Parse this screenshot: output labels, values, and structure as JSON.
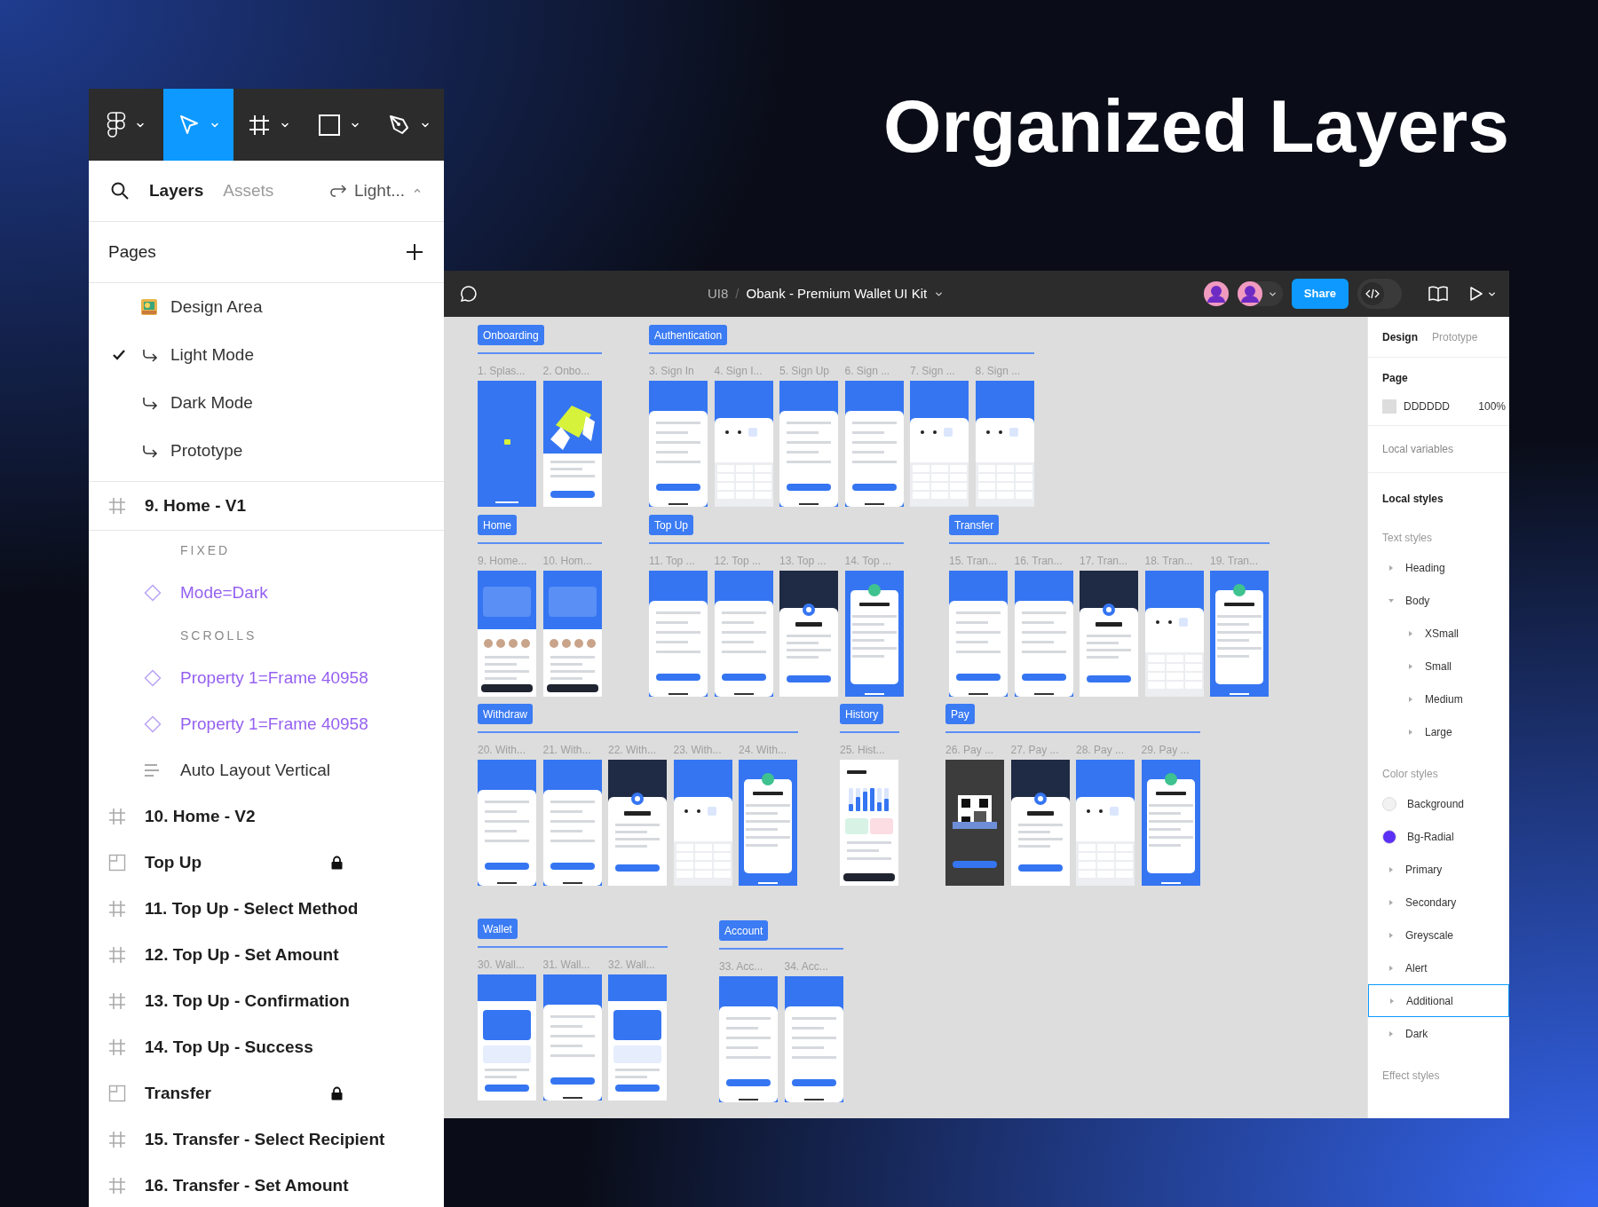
{
  "headline": "Organized Layers",
  "toolbar": {
    "tools": [
      {
        "kind": "logo",
        "selected": false
      },
      {
        "kind": "move",
        "selected": true
      },
      {
        "kind": "frame",
        "selected": false
      },
      {
        "kind": "rectangle",
        "selected": false
      },
      {
        "kind": "pen",
        "selected": false
      }
    ]
  },
  "layers_panel": {
    "tabs": [
      {
        "label": "Layers",
        "selected": true
      },
      {
        "label": "Assets",
        "selected": false
      }
    ],
    "page_switcher": "Light...",
    "pages_title": "Pages",
    "pages": [
      {
        "label": "Design Area",
        "kind": "emoji",
        "selected": false
      },
      {
        "label": "Light Mode",
        "kind": "link",
        "selected": true
      },
      {
        "label": "Dark Mode",
        "kind": "link",
        "selected": false
      },
      {
        "label": "Prototype",
        "kind": "link",
        "selected": false
      }
    ],
    "layers": [
      {
        "label": "9. Home - V1",
        "kind": "frame",
        "expanded": true,
        "children": [
          {
            "label": "FIXED",
            "kind": "group_label"
          },
          {
            "label": "Mode=Dark",
            "kind": "component"
          },
          {
            "label": "SCROLLS",
            "kind": "group_label"
          },
          {
            "label": "Property 1=Frame 40958",
            "kind": "component"
          },
          {
            "label": "Property 1=Frame 40958",
            "kind": "component"
          },
          {
            "label": "Auto Layout Vertical",
            "kind": "auto_layout"
          }
        ]
      },
      {
        "label": "10. Home - V2",
        "kind": "frame"
      },
      {
        "label": "Top Up",
        "kind": "section",
        "locked": true
      },
      {
        "label": "11. Top Up - Select Method",
        "kind": "frame"
      },
      {
        "label": "12. Top Up - Set Amount",
        "kind": "frame"
      },
      {
        "label": "13. Top Up - Confirmation",
        "kind": "frame"
      },
      {
        "label": "14. Top Up - Success",
        "kind": "frame"
      },
      {
        "label": "Transfer",
        "kind": "section",
        "locked": true
      },
      {
        "label": "15. Transfer - Select Recipient",
        "kind": "frame"
      },
      {
        "label": "16. Transfer - Set Amount",
        "kind": "frame"
      }
    ]
  },
  "editor": {
    "breadcrumb": {
      "team": "UI8",
      "separator": "/",
      "file": "Obank - Premium Wallet UI Kit"
    },
    "share_button": "Share",
    "dev_mode_on": false,
    "canvas": {
      "sections": [
        {
          "label": "Onboarding",
          "frames": [
            {
              "title": "1. Splas...",
              "kind": "splash"
            },
            {
              "title": "2. Onbo...",
              "kind": "illustration"
            }
          ]
        },
        {
          "label": "Authentication",
          "frames": [
            {
              "title": "3. Sign In",
              "kind": "form"
            },
            {
              "title": "4. Sign I...",
              "kind": "keypad"
            },
            {
              "title": "5. Sign Up",
              "kind": "form"
            },
            {
              "title": "6. Sign ...",
              "kind": "form"
            },
            {
              "title": "7. Sign ...",
              "kind": "keypad"
            },
            {
              "title": "8. Sign ...",
              "kind": "keypad"
            }
          ]
        },
        {
          "label": "Home",
          "frames": [
            {
              "title": "9. Home...",
              "kind": "home"
            },
            {
              "title": "10. Hom...",
              "kind": "home"
            }
          ]
        },
        {
          "label": "Top Up",
          "frames": [
            {
              "title": "11. Top ...",
              "kind": "form"
            },
            {
              "title": "12. Top ...",
              "kind": "form"
            },
            {
              "title": "13. Top ...",
              "kind": "dark"
            },
            {
              "title": "14. Top ...",
              "kind": "success"
            }
          ]
        },
        {
          "label": "Transfer",
          "frames": [
            {
              "title": "15. Tran...",
              "kind": "form"
            },
            {
              "title": "16. Tran...",
              "kind": "form"
            },
            {
              "title": "17. Tran...",
              "kind": "dark"
            },
            {
              "title": "18. Tran...",
              "kind": "keypad"
            },
            {
              "title": "19. Tran...",
              "kind": "success"
            }
          ]
        },
        {
          "label": "Withdraw",
          "frames": [
            {
              "title": "20. With...",
              "kind": "form"
            },
            {
              "title": "21. With...",
              "kind": "form"
            },
            {
              "title": "22. With...",
              "kind": "dark"
            },
            {
              "title": "23. With...",
              "kind": "keypad"
            },
            {
              "title": "24. With...",
              "kind": "success"
            }
          ]
        },
        {
          "label": "History",
          "frames": [
            {
              "title": "25. Hist...",
              "kind": "chart"
            }
          ]
        },
        {
          "label": "Pay",
          "frames": [
            {
              "title": "26. Pay ...",
              "kind": "qr"
            },
            {
              "title": "27. Pay ...",
              "kind": "dark"
            },
            {
              "title": "28. Pay ...",
              "kind": "keypad"
            },
            {
              "title": "29. Pay ...",
              "kind": "success"
            }
          ]
        },
        {
          "label": "Wallet",
          "frames": [
            {
              "title": "30. Wall...",
              "kind": "wallet"
            },
            {
              "title": "31. Wall...",
              "kind": "form"
            },
            {
              "title": "32. Wall...",
              "kind": "wallet"
            }
          ]
        },
        {
          "label": "Account",
          "frames": [
            {
              "title": "33. Acc...",
              "kind": "form"
            },
            {
              "title": "34. Acc...",
              "kind": "form"
            }
          ]
        }
      ]
    },
    "properties": {
      "tabs": [
        {
          "label": "Design",
          "selected": true
        },
        {
          "label": "Prototype",
          "selected": false
        }
      ],
      "page_title": "Page",
      "page_fill": {
        "hex": "DDDDDD",
        "opacity": "100%"
      },
      "local_variables": "Local variables",
      "local_styles": "Local styles",
      "text_styles_title": "Text styles",
      "text_styles": [
        {
          "label": "Heading",
          "expanded": false
        },
        {
          "label": "Body",
          "expanded": true,
          "children": [
            {
              "label": "XSmall",
              "expanded": false
            },
            {
              "label": "Small",
              "expanded": false
            },
            {
              "label": "Medium",
              "expanded": false
            },
            {
              "label": "Large",
              "expanded": false
            }
          ]
        }
      ],
      "color_styles_title": "Color styles",
      "color_styles": [
        {
          "label": "Background",
          "kind": "swatch",
          "color": "#f2f2f2",
          "selected": false
        },
        {
          "label": "Bg-Radial",
          "kind": "swatch",
          "color": "#5b2ff5",
          "selected": false
        },
        {
          "label": "Primary",
          "kind": "group",
          "expanded": false,
          "selected": false
        },
        {
          "label": "Secondary",
          "kind": "group",
          "expanded": false,
          "selected": false
        },
        {
          "label": "Greyscale",
          "kind": "group",
          "expanded": false,
          "selected": false
        },
        {
          "label": "Alert",
          "kind": "group",
          "expanded": false,
          "selected": false
        },
        {
          "label": "Additional",
          "kind": "group",
          "expanded": false,
          "selected": true
        },
        {
          "label": "Dark",
          "kind": "group",
          "expanded": false,
          "selected": false
        }
      ],
      "effect_styles_title": "Effect styles"
    }
  }
}
